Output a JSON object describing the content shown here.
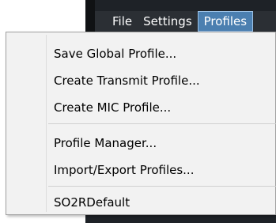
{
  "menubar": {
    "items": [
      "File",
      "Settings",
      "Profiles"
    ],
    "active": "Profiles"
  },
  "profiles_menu": {
    "items": [
      "Save Global Profile...",
      "Create Transmit Profile...",
      "Create MIC Profile...",
      "Profile Manager...",
      "Import/Export Profiles...",
      "SO2RDefault"
    ]
  }
}
